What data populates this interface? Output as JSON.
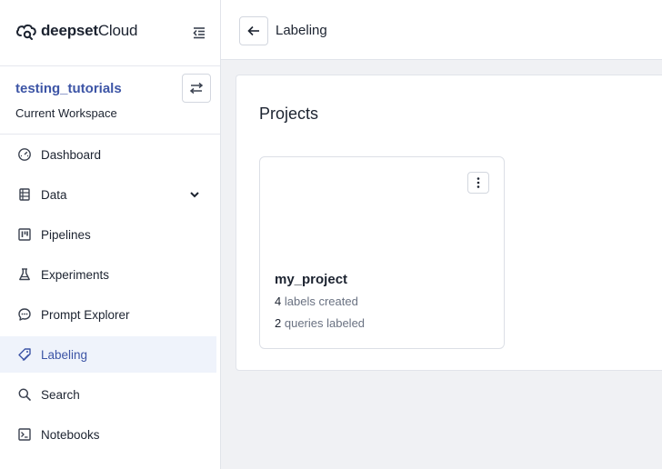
{
  "brand": {
    "name_bold": "deepset",
    "name_regular": "Cloud"
  },
  "workspace": {
    "name": "testing_tutorials",
    "subtitle": "Current Workspace"
  },
  "sidebar": {
    "items": [
      {
        "label": "Dashboard",
        "icon": "gauge-icon"
      },
      {
        "label": "Data",
        "icon": "database-icon"
      },
      {
        "label": "Pipelines",
        "icon": "kanban-icon"
      },
      {
        "label": "Experiments",
        "icon": "flask-icon"
      },
      {
        "label": "Prompt Explorer",
        "icon": "chat-icon"
      },
      {
        "label": "Labeling",
        "icon": "tag-icon",
        "active": true
      },
      {
        "label": "Search",
        "icon": "search-icon"
      },
      {
        "label": "Notebooks",
        "icon": "terminal-icon"
      }
    ]
  },
  "header": {
    "title": "Labeling"
  },
  "main": {
    "section_title": "Projects",
    "projects": [
      {
        "name": "my_project",
        "labels_count": "4",
        "labels_text": "labels created",
        "queries_count": "2",
        "queries_text": "queries labeled"
      }
    ]
  },
  "colors": {
    "accent": "#3d55a6",
    "active_bg": "#eff3fb",
    "page_bg": "#f0f1f4"
  }
}
